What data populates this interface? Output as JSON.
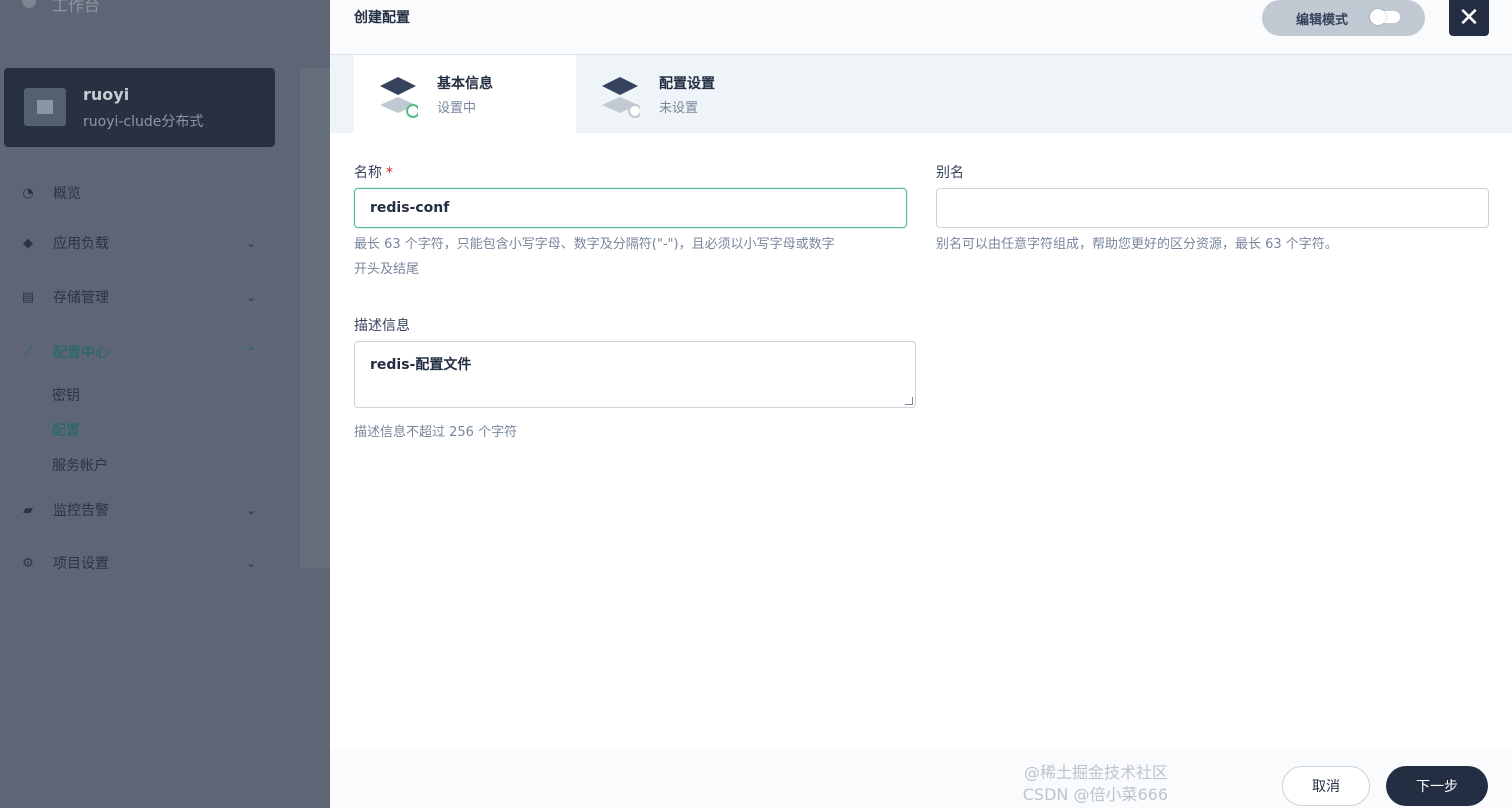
{
  "sidebar": {
    "workspace_title": "工作台",
    "project": {
      "name": "ruoyi",
      "description": "ruoyi-clude分布式"
    },
    "items": [
      {
        "label": "概览",
        "icon": "dashboard-icon"
      },
      {
        "label": "应用负载",
        "icon": "app-workload-icon"
      },
      {
        "label": "存储管理",
        "icon": "storage-icon"
      },
      {
        "label": "配置中心",
        "icon": "config-center-icon",
        "expanded": true
      },
      {
        "label": "监控告警",
        "icon": "monitoring-icon"
      },
      {
        "label": "项目设置",
        "icon": "gear-icon"
      }
    ],
    "sub_items": [
      "密钥",
      "配置",
      "服务帐户"
    ],
    "active_sub_item": "配置"
  },
  "modal": {
    "title": "创建配置",
    "edit_mode_label": "编辑模式",
    "close_icon": "close-icon",
    "steps": [
      {
        "title": "基本信息",
        "status": "设置中"
      },
      {
        "title": "配置设置",
        "status": "未设置"
      }
    ],
    "form": {
      "name_label": "名称",
      "required_mark": "*",
      "name_value": "redis-conf",
      "name_hint_line1": "最长 63 个字符，只能包含小写字母、数字及分隔符(\"-\")，且必须以小写字母或数字",
      "name_hint_line2": "开头及结尾",
      "alias_label": "别名",
      "alias_value": "",
      "alias_hint": "别名可以由任意字符组成，帮助您更好的区分资源，最长 63 个字符。",
      "description_label": "描述信息",
      "description_value": "redis-配置文件",
      "description_hint": "描述信息不超过 256 个字符"
    },
    "footer": {
      "cancel_label": "取消",
      "next_label": "下一步"
    }
  },
  "watermark": "@稀土掘金技术社区\nCSDN @倍小菜666",
  "colors": {
    "accent_green": "#55bc8a",
    "dark": "#242e42",
    "required": "#ca2621"
  }
}
